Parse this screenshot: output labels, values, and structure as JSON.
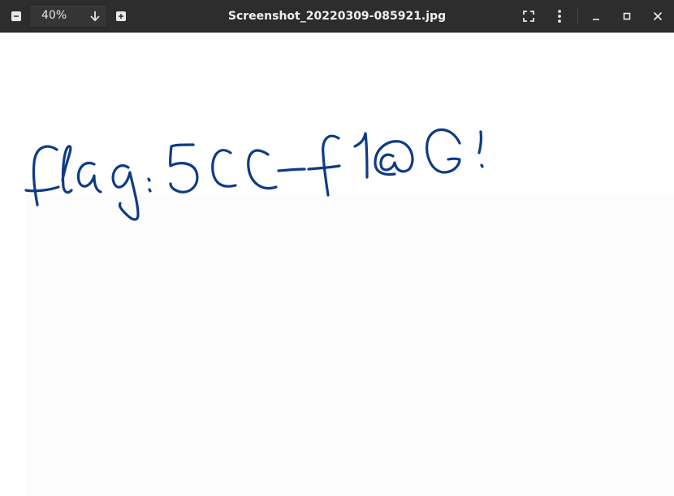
{
  "window": {
    "title": "Screenshot_20220309-085921.jpg"
  },
  "toolbar": {
    "zoom_out_icon": "minus-square-icon",
    "zoom_value": "40%",
    "zoom_dropdown_icon": "arrow-down-icon",
    "zoom_in_icon": "plus-square-icon",
    "fullscreen_icon": "fullscreen-icon",
    "menu_icon": "vertical-dots-icon",
    "minimize_icon": "minimize-icon",
    "maximize_icon": "maximize-icon",
    "close_icon": "close-icon"
  },
  "image": {
    "handwritten_text": "flag:5CC-f1@G!",
    "ink_color": "#0d3b86",
    "background_color": "#ffffff"
  },
  "colors": {
    "titlebar_bg": "#2d2d2d",
    "titlebar_text": "#f0f0f0"
  }
}
